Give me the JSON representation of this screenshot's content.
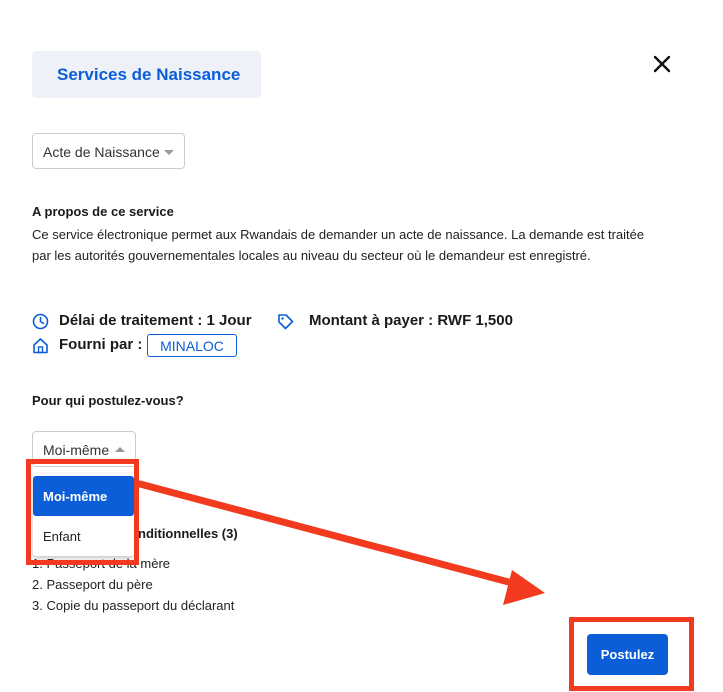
{
  "header": {
    "title": "Services de Naissance"
  },
  "service_select": {
    "value": "Acte de Naissance"
  },
  "about": {
    "heading": "A propos de ce service",
    "description": "Ce service électronique permet aux Rwandais de demander un acte de naissance. La demande est traitée par les autorités gouvernementales locales au niveau du secteur où le demandeur est enregistré."
  },
  "meta": {
    "processing_time": "Délai de traitement : 1 Jour",
    "amount": "Montant à payer : RWF 1,500",
    "provider_label": "Fourni par :",
    "provider_value": "MINALOC"
  },
  "applicant": {
    "question": "Pour qui postulez-vous?",
    "selected": "Moi-même",
    "options": [
      "Moi-même",
      "Enfant"
    ]
  },
  "documents": {
    "heading_visible": "nditionnelles (3)",
    "items": [
      "1. Passeport de la mère",
      "2. Passeport du père",
      "3. Copie du passeport du déclarant"
    ]
  },
  "actions": {
    "apply_label": "Postulez"
  },
  "colors": {
    "accent": "#0b5ed7",
    "highlight": "#f23a1e",
    "title_bg": "#eef2f8"
  },
  "icons": {
    "close": "close-icon",
    "clock": "clock-icon",
    "tag": "tag-icon",
    "building": "building-icon"
  }
}
